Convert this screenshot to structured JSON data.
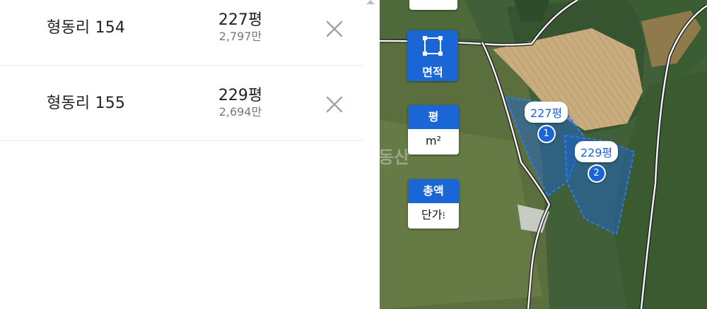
{
  "list": [
    {
      "name": "형동리 154",
      "area": "227평",
      "price": "2,797만"
    },
    {
      "name": "형동리 155",
      "area": "229평",
      "price": "2,694만"
    }
  ],
  "map": {
    "controls": {
      "area_label": "면적",
      "unit_top": "평",
      "unit_bottom": "m²",
      "price_top": "총액",
      "price_bottom": "단가"
    },
    "markers": [
      {
        "label": "227평",
        "number": "1"
      },
      {
        "label": "229평",
        "number": "2"
      }
    ],
    "watermark": "동산",
    "colors": {
      "accent": "#1a66d6",
      "parcel_fill": "#1a66d6"
    }
  }
}
